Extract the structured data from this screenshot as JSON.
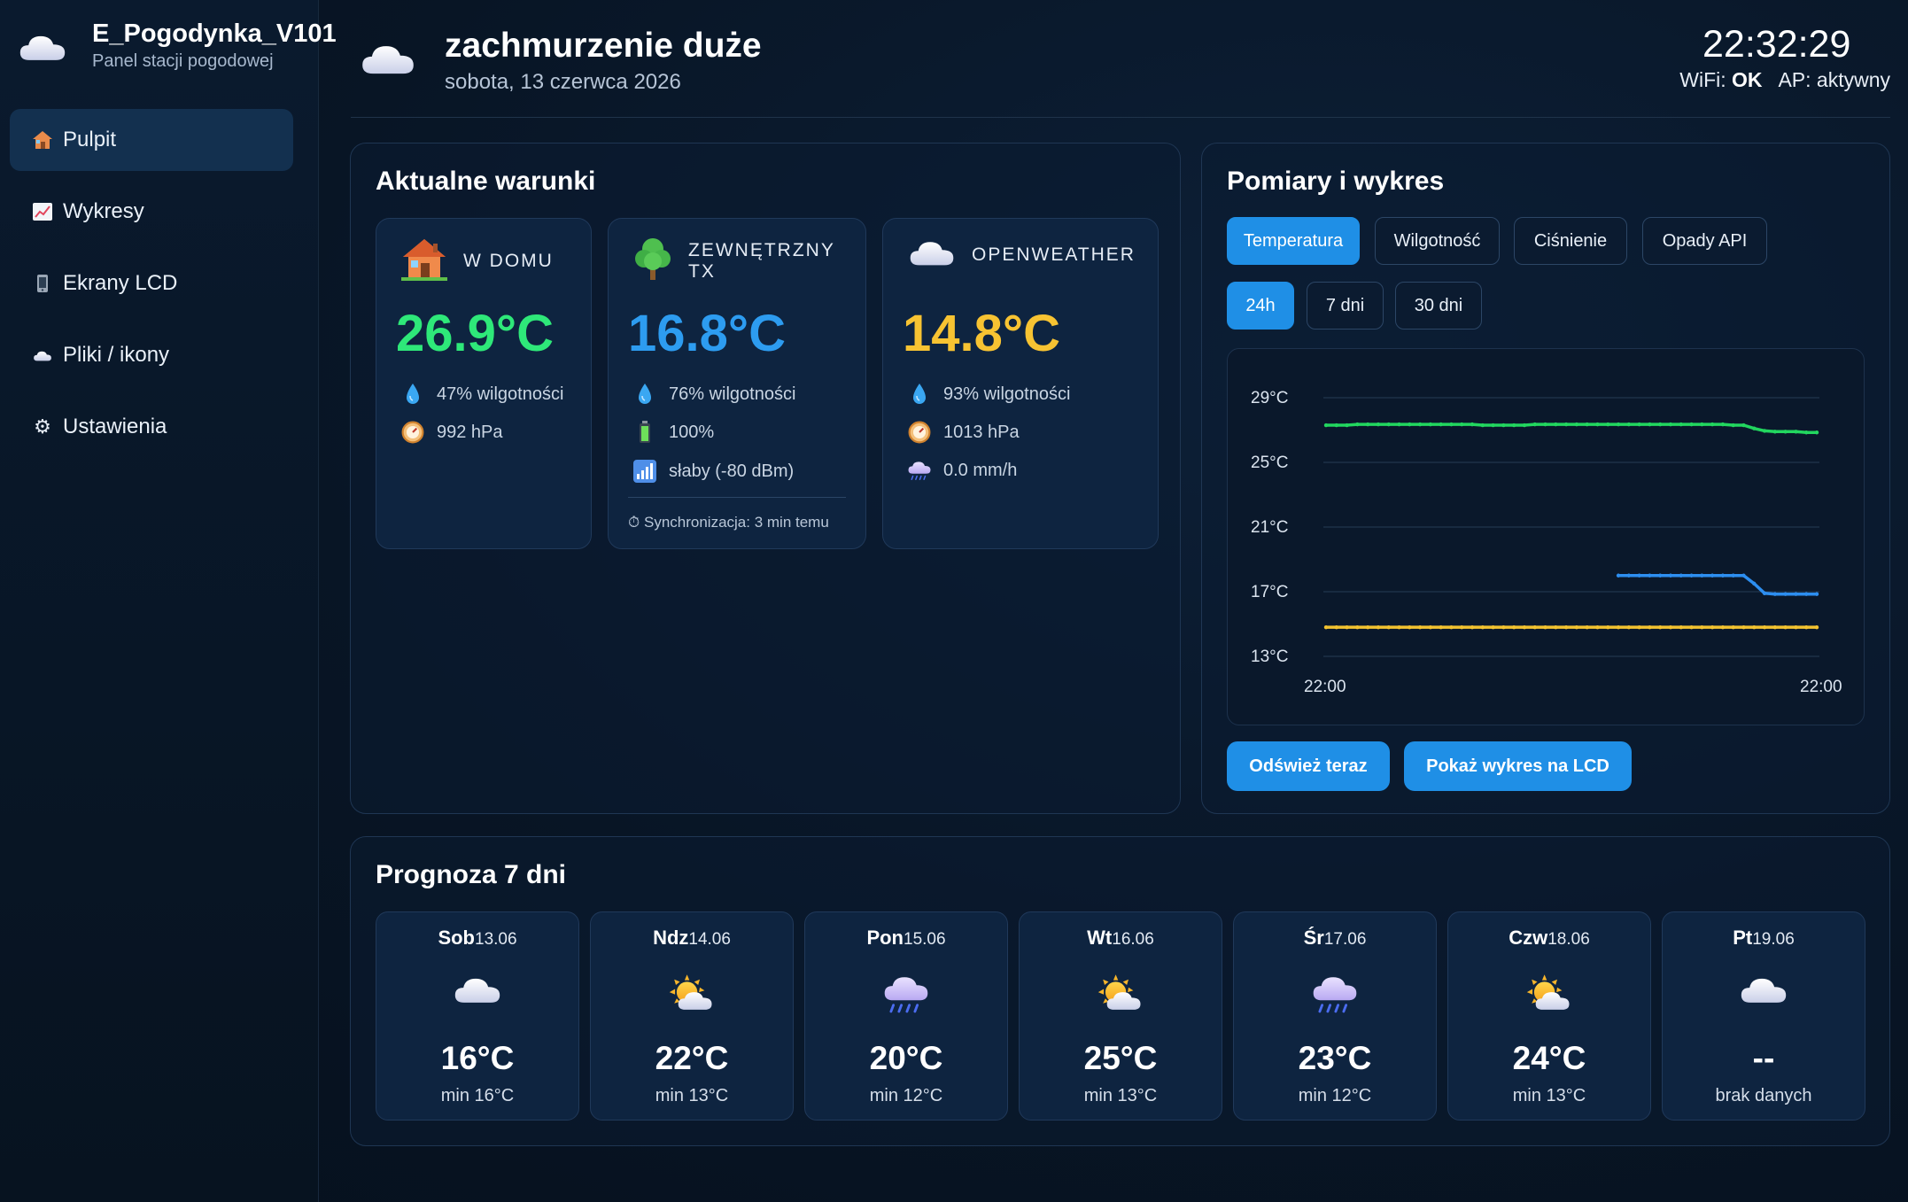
{
  "app": {
    "title": "E_Pogodynka_V101",
    "subtitle": "Panel stacji pogodowej",
    "logo_icon": "cloud-icon"
  },
  "nav": [
    {
      "label": "Pulpit",
      "icon": "house-icon",
      "active": true
    },
    {
      "label": "Wykresy",
      "icon": "chart-icon"
    },
    {
      "label": "Ekrany LCD",
      "icon": "phone-icon"
    },
    {
      "label": "Pliki / ikony",
      "icon": "cloud-icon"
    },
    {
      "label": "Ustawienia",
      "icon": "gear-icon"
    }
  ],
  "header": {
    "condition": "zachmurzenie duże",
    "date": "sobota, 13 czerwca 2026",
    "time": "22:32:29",
    "wifi_label": "WiFi:",
    "wifi_value": "OK",
    "ap_label": "AP:",
    "ap_value": "aktywny"
  },
  "current": {
    "title": "Aktualne warunki",
    "home": {
      "label": "W DOMU",
      "temp": "26.9°C",
      "humidity": "47% wilgotności",
      "pressure": "992 hPa",
      "color": "#2ee879"
    },
    "outdoor": {
      "label": "ZEWNĘTRZNY TX",
      "temp": "16.8°C",
      "humidity": "76% wilgotności",
      "battery": "100%",
      "signal": "słaby (-80 dBm)",
      "sync": "⏱ Synchronizacja: 3 min temu",
      "color": "#2d9cf0"
    },
    "owm": {
      "label": "OPENWEATHER",
      "temp": "14.8°C",
      "humidity": "93% wilgotności",
      "pressure": "1013 hPa",
      "rain": "0.0 mm/h",
      "color": "#f7c332"
    }
  },
  "chart_panel": {
    "title": "Pomiary i wykres",
    "metric_tabs": [
      "Temperatura",
      "Wilgotność",
      "Ciśnienie",
      "Opady API"
    ],
    "active_metric": "Temperatura",
    "range_tabs": [
      "24h",
      "7 dni",
      "30 dni"
    ],
    "active_range": "24h",
    "refresh_label": "Odśwież teraz",
    "lcd_label": "Pokaż wykres na LCD"
  },
  "chart_data": {
    "type": "line",
    "y_ticks": [
      "29°C",
      "25°C",
      "21°C",
      "17°C",
      "13°C"
    ],
    "ylim": [
      13,
      29
    ],
    "x_ticks": [
      "22:00",
      "22:00"
    ],
    "grid": true,
    "series": [
      {
        "color": "#22d65f",
        "values": [
          27.3,
          27.3,
          27.3,
          27.35,
          27.35,
          27.35,
          27.35,
          27.35,
          27.35,
          27.35,
          27.35,
          27.35,
          27.35,
          27.35,
          27.35,
          27.3,
          27.3,
          27.3,
          27.3,
          27.3,
          27.35,
          27.35,
          27.35,
          27.35,
          27.35,
          27.35,
          27.35,
          27.35,
          27.35,
          27.35,
          27.35,
          27.35,
          27.35,
          27.35,
          27.35,
          27.35,
          27.35,
          27.35,
          27.35,
          27.3,
          27.3,
          27.1,
          26.95,
          26.9,
          26.9,
          26.9,
          26.85,
          26.85
        ]
      },
      {
        "color": "#2d8ef0",
        "values": [
          null,
          null,
          null,
          null,
          null,
          null,
          null,
          null,
          null,
          null,
          null,
          null,
          null,
          null,
          null,
          null,
          null,
          null,
          null,
          null,
          null,
          null,
          null,
          null,
          null,
          null,
          null,
          null,
          18.0,
          18.0,
          18.0,
          18.0,
          18.0,
          18.0,
          18.0,
          18.0,
          18.0,
          18.0,
          18.0,
          18.0,
          18.0,
          17.5,
          16.9,
          16.85,
          16.85,
          16.85,
          16.85,
          16.85
        ]
      },
      {
        "color": "#f2c230",
        "values": [
          14.8,
          14.8,
          14.8,
          14.8,
          14.8,
          14.8,
          14.8,
          14.8,
          14.8,
          14.8,
          14.8,
          14.8,
          14.8,
          14.8,
          14.8,
          14.8,
          14.8,
          14.8,
          14.8,
          14.8,
          14.8,
          14.8,
          14.8,
          14.8,
          14.8,
          14.8,
          14.8,
          14.8,
          14.8,
          14.8,
          14.8,
          14.8,
          14.8,
          14.8,
          14.8,
          14.8,
          14.8,
          14.8,
          14.8,
          14.8,
          14.8,
          14.8,
          14.8,
          14.8,
          14.8,
          14.8,
          14.8,
          14.8
        ]
      }
    ]
  },
  "forecast": {
    "title": "Prognoza 7 dni",
    "days": [
      {
        "day": "Sob",
        "date": "13.06",
        "icon": "cloud-icon",
        "max": "16°C",
        "min": "min 16°C"
      },
      {
        "day": "Ndz",
        "date": "14.06",
        "icon": "sun-cloud-icon",
        "max": "22°C",
        "min": "min 13°C"
      },
      {
        "day": "Pon",
        "date": "15.06",
        "icon": "rain-cloud-icon",
        "max": "20°C",
        "min": "min 12°C"
      },
      {
        "day": "Wt",
        "date": "16.06",
        "icon": "sun-cloud-icon",
        "max": "25°C",
        "min": "min 13°C"
      },
      {
        "day": "Śr",
        "date": "17.06",
        "icon": "rain-cloud-icon",
        "max": "23°C",
        "min": "min 12°C"
      },
      {
        "day": "Czw",
        "date": "18.06",
        "icon": "sun-cloud-icon",
        "max": "24°C",
        "min": "min 13°C"
      },
      {
        "day": "Pt",
        "date": "19.06",
        "icon": "cloud-icon",
        "max": "--",
        "min": "brak danych"
      }
    ]
  }
}
